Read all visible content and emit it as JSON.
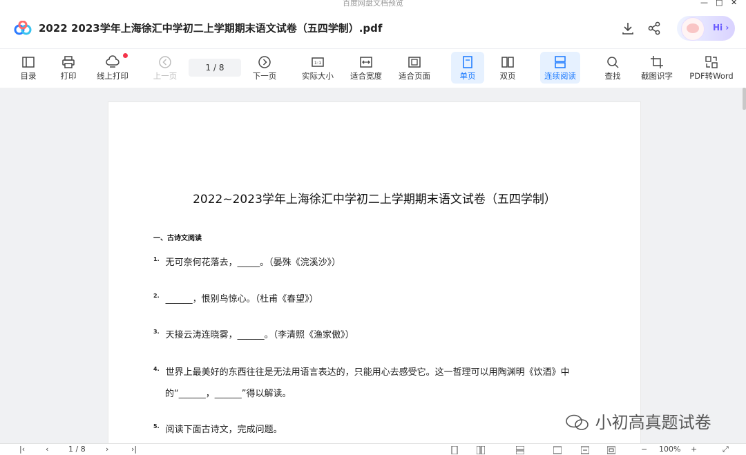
{
  "window": {
    "title": "百度网盘文档预览"
  },
  "header": {
    "title": "2022 2023学年上海徐汇中学初二上学期期末语文试卷（五四学制）.pdf",
    "hi_label": "Hi ›"
  },
  "toolbar": {
    "items": [
      {
        "label": "目录",
        "icon": "toc-icon"
      },
      {
        "label": "打印",
        "icon": "printer-icon"
      },
      {
        "label": "线上打印",
        "icon": "cloud-print-icon"
      },
      {
        "label": "上一页",
        "icon": "prev-page-icon"
      },
      {
        "label": "下一页",
        "icon": "next-page-icon"
      },
      {
        "label": "实际大小",
        "icon": "actual-size-icon"
      },
      {
        "label": "适合宽度",
        "icon": "fit-width-icon"
      },
      {
        "label": "适合页面",
        "icon": "fit-page-icon"
      },
      {
        "label": "单页",
        "icon": "single-page-icon"
      },
      {
        "label": "双页",
        "icon": "double-page-icon"
      },
      {
        "label": "连续阅读",
        "icon": "continuous-read-icon"
      },
      {
        "label": "查找",
        "icon": "search-icon"
      },
      {
        "label": "截图识字",
        "icon": "screenshot-ocr-icon"
      },
      {
        "label": "PDF转Word",
        "icon": "pdf-to-word-icon"
      }
    ],
    "page_indicator": "1 / 8"
  },
  "document": {
    "title": "2022~2023学年上海徐汇中学初二上学期期末语文试卷（五四学制）",
    "section": "一、古诗文阅读",
    "questions": [
      {
        "num": "1.",
        "text": "无可奈何花落去，_____。（晏殊《浣溪沙》）"
      },
      {
        "num": "2.",
        "text": "______，恨别鸟惊心。（杜甫《春望》）"
      },
      {
        "num": "3.",
        "text": "天接云涛连晓雾，______。（李清照《渔家傲》）"
      },
      {
        "num": "4.",
        "text": "世界上最美好的东西往往是无法用语言表达的，只能用心去感受它。这一哲理可以用陶渊明《饮酒》中",
        "text2": "的“______，______”得以解读。"
      },
      {
        "num": "5.",
        "text": "阅读下面古诗文，完成问题。"
      }
    ]
  },
  "watermark": {
    "text": "小初高真题试卷"
  },
  "statusbar": {
    "page": "1 / 8",
    "zoom": "100%",
    "minus": "−",
    "plus": "+"
  },
  "colors": {
    "accent": "#1677ff",
    "active_bg": "#e6f1ff",
    "badge": "#f5344a"
  }
}
